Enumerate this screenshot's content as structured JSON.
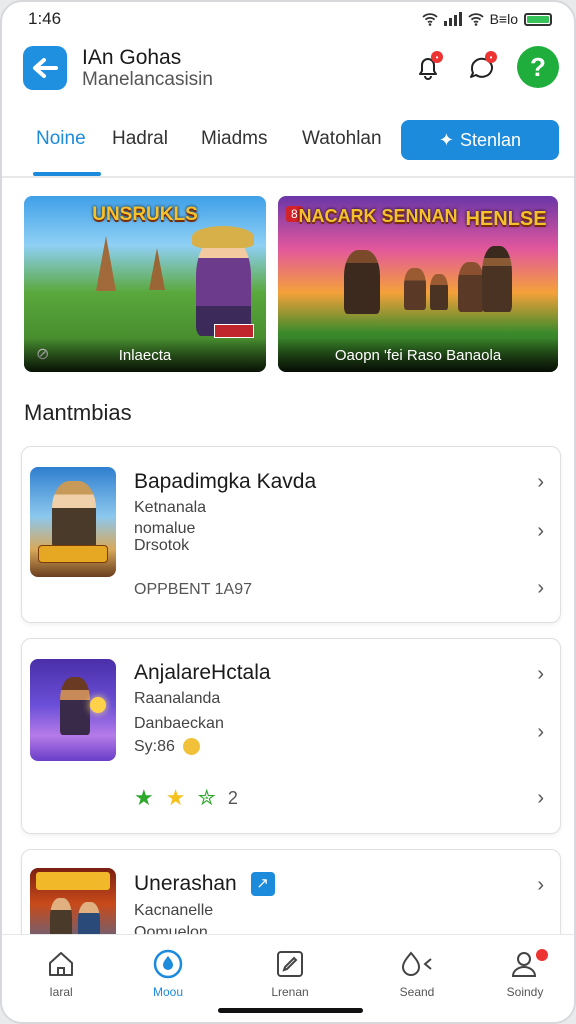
{
  "status": {
    "time": "1:46",
    "right_label": "B≡lo"
  },
  "header": {
    "title": "IAn Gohas",
    "subtitle": "Manelancasisin"
  },
  "tabs": [
    {
      "label": "Noine"
    },
    {
      "label": "Hadral"
    },
    {
      "label": "Miadms"
    },
    {
      "label": "Watohlan"
    }
  ],
  "tab_button": {
    "label": "Stenlan"
  },
  "features": [
    {
      "title": "UNSRUKLS",
      "caption": "Inlaecta"
    },
    {
      "title": "NACARK SENNAN",
      "title2": "HENLSE",
      "tag": "8",
      "caption": "Oaopn 'fei Raso Banaola"
    }
  ],
  "section_title": "Mantmbias",
  "cards": [
    {
      "name": "Bapadimgka Kavda",
      "line1": "Ketnanala",
      "line2": "nomalue",
      "line3": "Drsotok",
      "footer": "OPPBENT  1A97"
    },
    {
      "name": "AnjalareHctala",
      "line1": "Raanalanda",
      "line2": "Danbaeckan",
      "line3": "Sy:86",
      "rating_count": "2"
    },
    {
      "name": "Unerashan",
      "line1": "Kacnanelle",
      "line2": "Oomuelon"
    }
  ],
  "bottom_nav": [
    {
      "label": "Iaral",
      "icon": "home-icon"
    },
    {
      "label": "Moou",
      "icon": "drop-icon"
    },
    {
      "label": "Lrenan",
      "icon": "edit-icon"
    },
    {
      "label": "Seand",
      "icon": "fire-icon"
    },
    {
      "label": "Soindy",
      "icon": "user-icon"
    }
  ],
  "colors": {
    "accent": "#1d8bdc",
    "help": "#1fae3c",
    "badge": "#e33333"
  }
}
